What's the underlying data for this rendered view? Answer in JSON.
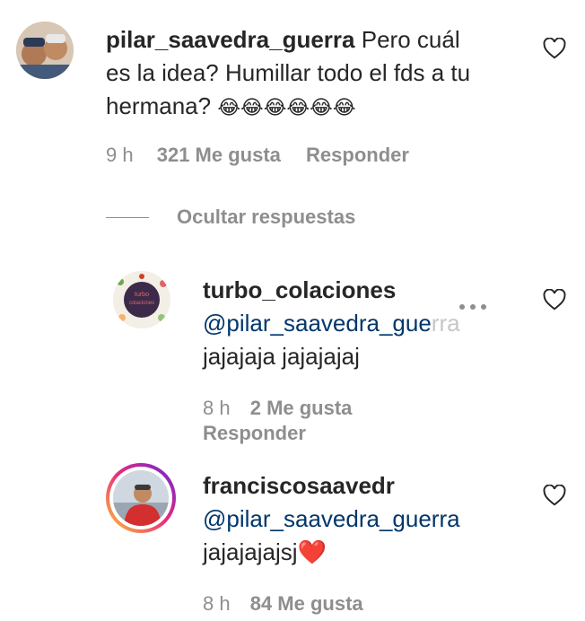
{
  "comment": {
    "username": "pilar_saavedra_guerra",
    "text_line1": "Pero cuál",
    "text_line2": "es la idea? Humillar todo el fds a tu",
    "text_line3": "hermana?",
    "emojis": "😂😂😂😂😂😂",
    "time": "9 h",
    "likes": "321 Me gusta",
    "reply": "Responder"
  },
  "hide_replies": "Ocultar respuestas",
  "replies": [
    {
      "username": "turbo_colaciones",
      "mention": "@pilar_saavedra_gue",
      "mention_fade": "rra",
      "text": "jajajaja jajajajaj",
      "time": "8 h",
      "likes": "2 Me gusta",
      "reply": "Responder",
      "avatar_text": "turbo colaciones"
    },
    {
      "username": "franciscosaavedr",
      "mention": "@pilar_saavedra_guerra",
      "text": "jajajajajsj❤️",
      "time": "8 h",
      "likes": "84 Me gusta"
    }
  ]
}
